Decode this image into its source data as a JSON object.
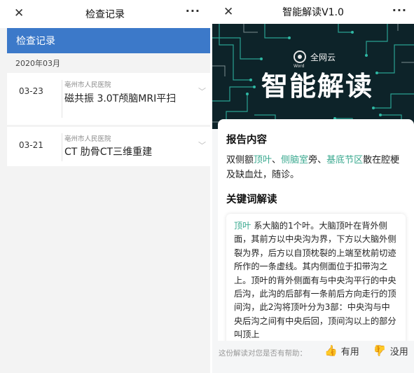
{
  "left": {
    "title": "检查记录",
    "close_icon": "close-icon",
    "more_icon": "more-icon",
    "close_glyph": "✕",
    "more_glyph": "···",
    "section_header": "检查记录",
    "month": "2020年03月",
    "records": [
      {
        "date": "03-23",
        "hospital": "亳州市人民医院",
        "exam": "磁共振  3.0T颅脑MRI平扫"
      },
      {
        "date": "03-21",
        "hospital": "亳州市人民医院",
        "exam": "CT  肋骨CT三维重建"
      }
    ],
    "chevron_glyph": "﹀"
  },
  "right": {
    "title": "智能解读V1.0",
    "close_glyph": "✕",
    "more_glyph": "···",
    "banner": {
      "brand_name": "全网云",
      "brand_sub": "Word",
      "big_title": "智能解读"
    },
    "report_title": "报告内容",
    "report": {
      "p1": "双侧额",
      "k1": "顶叶",
      "p2": "、",
      "k2": "侧脑室",
      "p3": "旁、",
      "k3": "基底节区",
      "p4": "散在腔梗及缺血灶，随诊。"
    },
    "keyword_title": "关键词解读",
    "keyword": {
      "term": "顶叶",
      "text": "  系大脑的1个叶。大脑顶叶在背外侧面，其前方以中央沟为界，下方以大脑外侧裂为界，后方以自顶枕裂的上端至枕前切迹所作的一条虚线。其内侧面位于扣带沟之上。顶叶的背外侧面有与中央沟平行的中央后沟，此沟的后部有一条前后方向走行的顶间沟，此2沟将顶叶分为3部：中央沟与中央后沟之间有中央后回，顶间沟以上的部分叫顶上"
    },
    "feedback": {
      "question": "这份解读对您是否有帮助：",
      "useful": "有用",
      "useless": "没用"
    },
    "colors": {
      "keyword": "#3aa98f",
      "banner_bg": "#0d2329",
      "header_blue": "#3c79c9"
    }
  }
}
